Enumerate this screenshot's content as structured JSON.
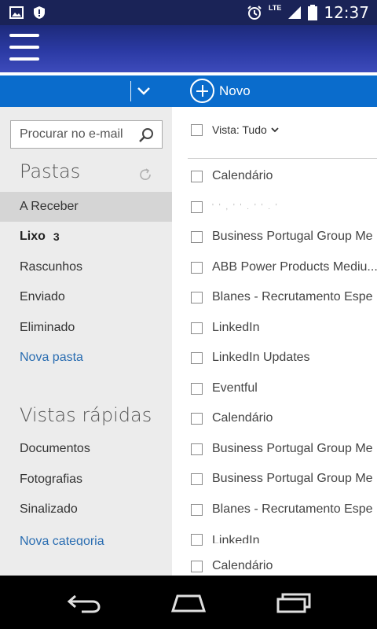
{
  "status_bar": {
    "time": "12:37",
    "network": "LTE",
    "icons": [
      "image-icon",
      "shield-icon",
      "alarm-icon",
      "signal-icon",
      "battery-icon"
    ]
  },
  "header": {
    "menu_icon": "hamburger-icon"
  },
  "toolbar": {
    "new_label": "Novo",
    "dropdown_icon": "chevron-down-icon",
    "new_icon": "plus-circle-icon"
  },
  "sidebar": {
    "search_placeholder": "Procurar no e-mail",
    "folders_title": "Pastas",
    "folders": [
      {
        "label": "A Receber"
      },
      {
        "label": "Lixo",
        "count": "3"
      },
      {
        "label": "Rascunhos"
      },
      {
        "label": "Enviado"
      },
      {
        "label": "Eliminado"
      }
    ],
    "new_folder": "Nova pasta",
    "quick_views_title": "Vistas rápidas",
    "quick_views": [
      {
        "label": "Documentos"
      },
      {
        "label": "Fotografias"
      },
      {
        "label": "Sinalizado"
      }
    ],
    "new_category": "Nova categoria"
  },
  "message_list": {
    "filter_label": "Vista: Tudo",
    "messages": [
      {
        "sender": "Calendário"
      },
      {
        "sender": "' ' ,   '  '  .       '       '   .   '"
      },
      {
        "sender": "Business Portugal Group Me"
      },
      {
        "sender": "ABB Power Products Mediu..."
      },
      {
        "sender": "Blanes - Recrutamento Espe"
      },
      {
        "sender": "LinkedIn"
      },
      {
        "sender": "LinkedIn Updates"
      },
      {
        "sender": "Eventful"
      },
      {
        "sender": "Calendário"
      },
      {
        "sender": "Business Portugal Group Me"
      },
      {
        "sender": "Business Portugal Group Me"
      },
      {
        "sender": "Blanes - Recrutamento Espe"
      },
      {
        "sender": "LinkedIn"
      },
      {
        "sender": "Calendário"
      }
    ]
  },
  "colors": {
    "status_bar": "#1a2357",
    "header": "#2b3aa4",
    "toolbar": "#0a6ccc",
    "sidebar": "#ececec",
    "selected": "#d5d5d5",
    "link": "#2a6db1"
  },
  "android_nav": {
    "icons": [
      "back-icon",
      "home-icon",
      "recents-icon"
    ]
  }
}
